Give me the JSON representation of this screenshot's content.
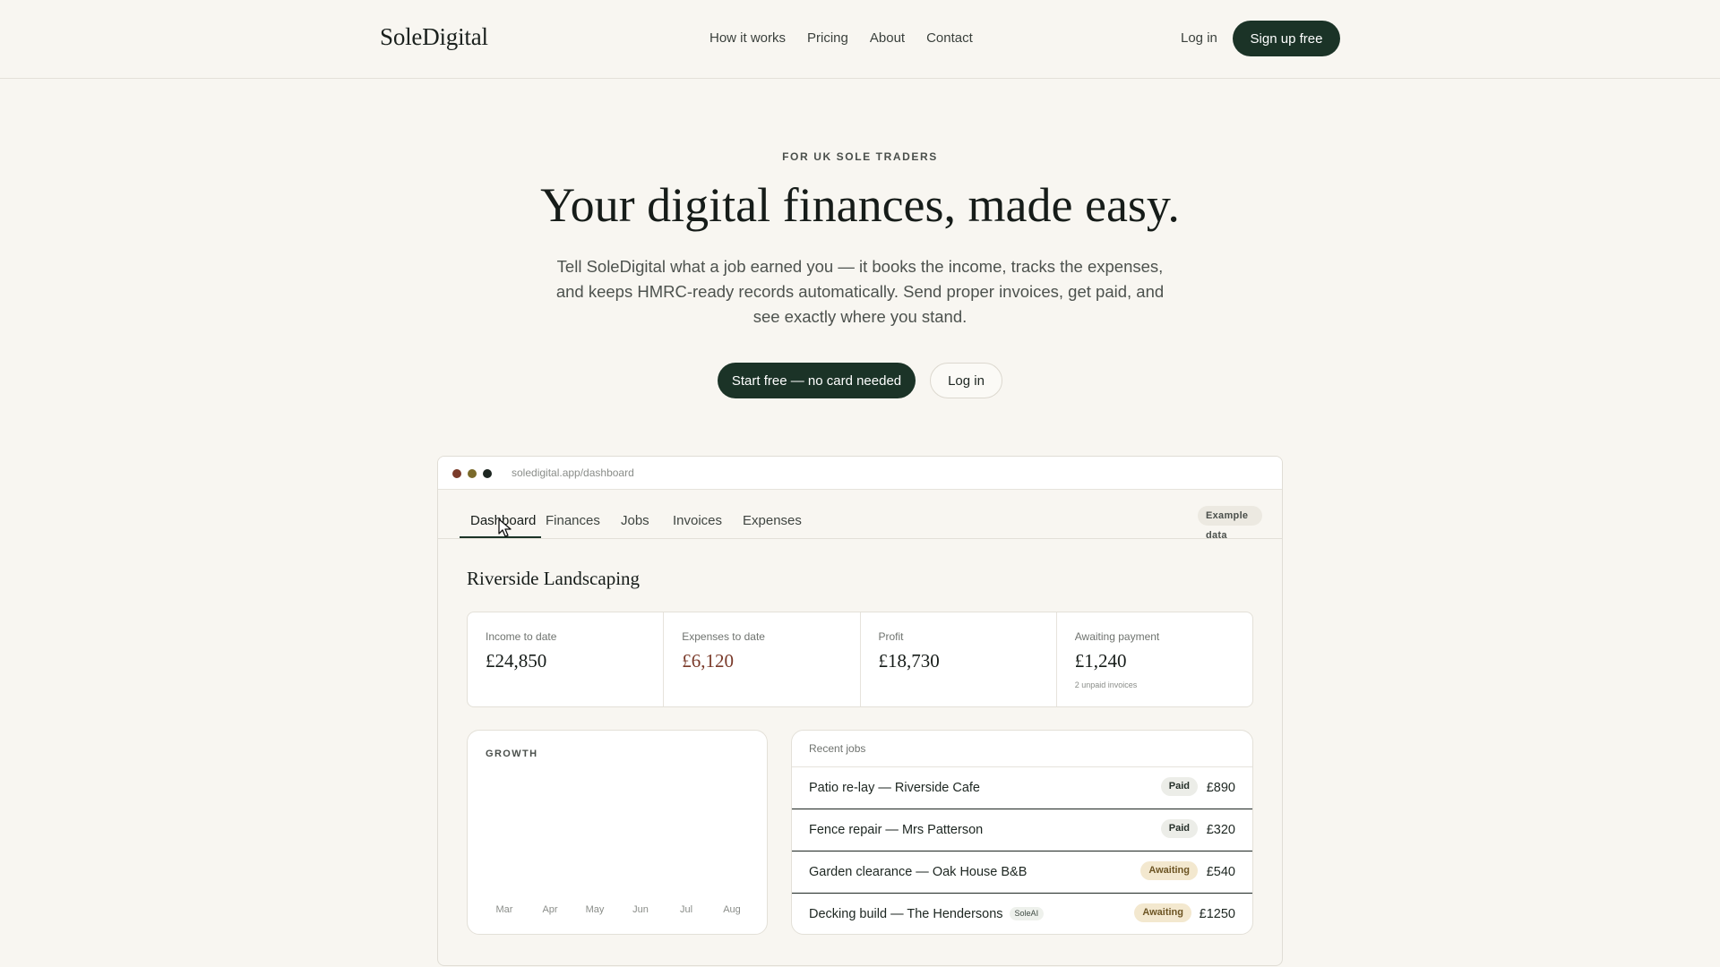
{
  "nav": {
    "logo": "SoleDigital",
    "links": [
      "How it works",
      "Pricing",
      "About",
      "Contact"
    ],
    "login": "Log in",
    "signup": "Sign up free"
  },
  "hero": {
    "eyebrow": "FOR UK SOLE TRADERS",
    "title": "Your digital finances, made easy.",
    "subtitle": "Tell SoleDigital what a job earned you — it books the income, tracks the expenses, and keeps HMRC-ready records automatically. Send proper invoices, get paid, and see exactly where you stand.",
    "cta_primary": "Start free — no card needed",
    "cta_secondary": "Log in"
  },
  "window": {
    "url": "soledigital.app/dashboard",
    "dot_colors": [
      "#7a3b2a",
      "#7a6a2a",
      "#1d2621"
    ],
    "tabs": [
      "Dashboard",
      "Finances",
      "Jobs",
      "Invoices",
      "Expenses"
    ],
    "active_tab": "Dashboard",
    "badge": "Example data",
    "business_name": "Riverside Landscaping",
    "stats": {
      "income": {
        "label": "Income to date",
        "value": "£24,850"
      },
      "expenses": {
        "label": "Expenses to date",
        "value": "£6,120"
      },
      "profit": {
        "label": "Profit",
        "value": "£18,730"
      },
      "awaiting": {
        "label": "Awaiting payment",
        "value": "£1,240",
        "note": "2 unpaid invoices"
      }
    },
    "growth": {
      "title": "GROWTH",
      "months": [
        "Mar",
        "Apr",
        "May",
        "Jun",
        "Jul",
        "Aug"
      ]
    },
    "jobs": {
      "title": "Recent jobs",
      "rows": [
        {
          "name": "Patio re-lay — Riverside Cafe",
          "tag": "",
          "status": "Paid",
          "amount": "£890"
        },
        {
          "name": "Fence repair — Mrs Patterson",
          "tag": "",
          "status": "Paid",
          "amount": "£320"
        },
        {
          "name": "Garden clearance — Oak House B&B",
          "tag": "",
          "status": "Awaiting",
          "amount": "£540"
        },
        {
          "name": "Decking build — The Hendersons",
          "tag": "SoleAI",
          "status": "Awaiting",
          "amount": "£1250"
        }
      ]
    }
  },
  "colors": {
    "brand": "#1b3327",
    "background": "#f8f6f1",
    "expense": "#7a3a2a",
    "awaiting_bg": "#f3e8cf",
    "paid_bg": "#ecede8"
  }
}
